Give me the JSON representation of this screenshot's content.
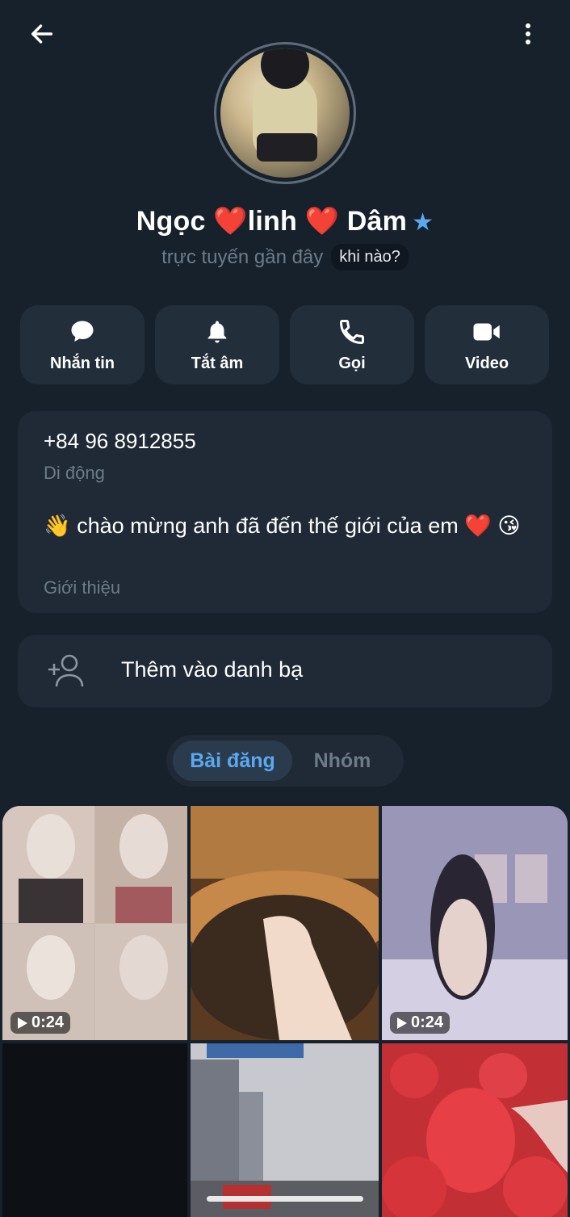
{
  "header": {
    "back_icon": "arrow-left-icon",
    "more_icon": "more-vertical-icon"
  },
  "profile": {
    "name": "Ngọc ❤️linh ❤️ Dâm",
    "star_icon": "★",
    "status": "trực tuyến gần đây",
    "when_chip": "khi nào?"
  },
  "actions": [
    {
      "label": "Nhắn tin",
      "icon": "chat-bubble-icon"
    },
    {
      "label": "Tắt âm",
      "icon": "bell-icon"
    },
    {
      "label": "Gọi",
      "icon": "phone-icon"
    },
    {
      "label": "Video",
      "icon": "video-camera-icon"
    }
  ],
  "info": {
    "phone": "+84 96 8912855",
    "phone_label": "Di động",
    "bio": "👋 chào mừng anh đã đến thế giới của em ❤️ 😘",
    "bio_label": "Giới thiệu"
  },
  "add_contact": {
    "label": "Thêm vào danh bạ",
    "icon": "add-person-icon"
  },
  "tabs": [
    {
      "label": "Bài đăng",
      "active": true
    },
    {
      "label": "Nhóm",
      "active": false
    }
  ],
  "media": [
    {
      "type": "video",
      "duration": "0:24"
    },
    {
      "type": "photo"
    },
    {
      "type": "video",
      "duration": "0:24"
    },
    {
      "type": "photo"
    },
    {
      "type": "photo"
    },
    {
      "type": "photo"
    }
  ],
  "colors": {
    "background": "#17212b",
    "card": "#1f2a36",
    "accent": "#5aa9f0",
    "muted_text": "#6d7b89"
  }
}
